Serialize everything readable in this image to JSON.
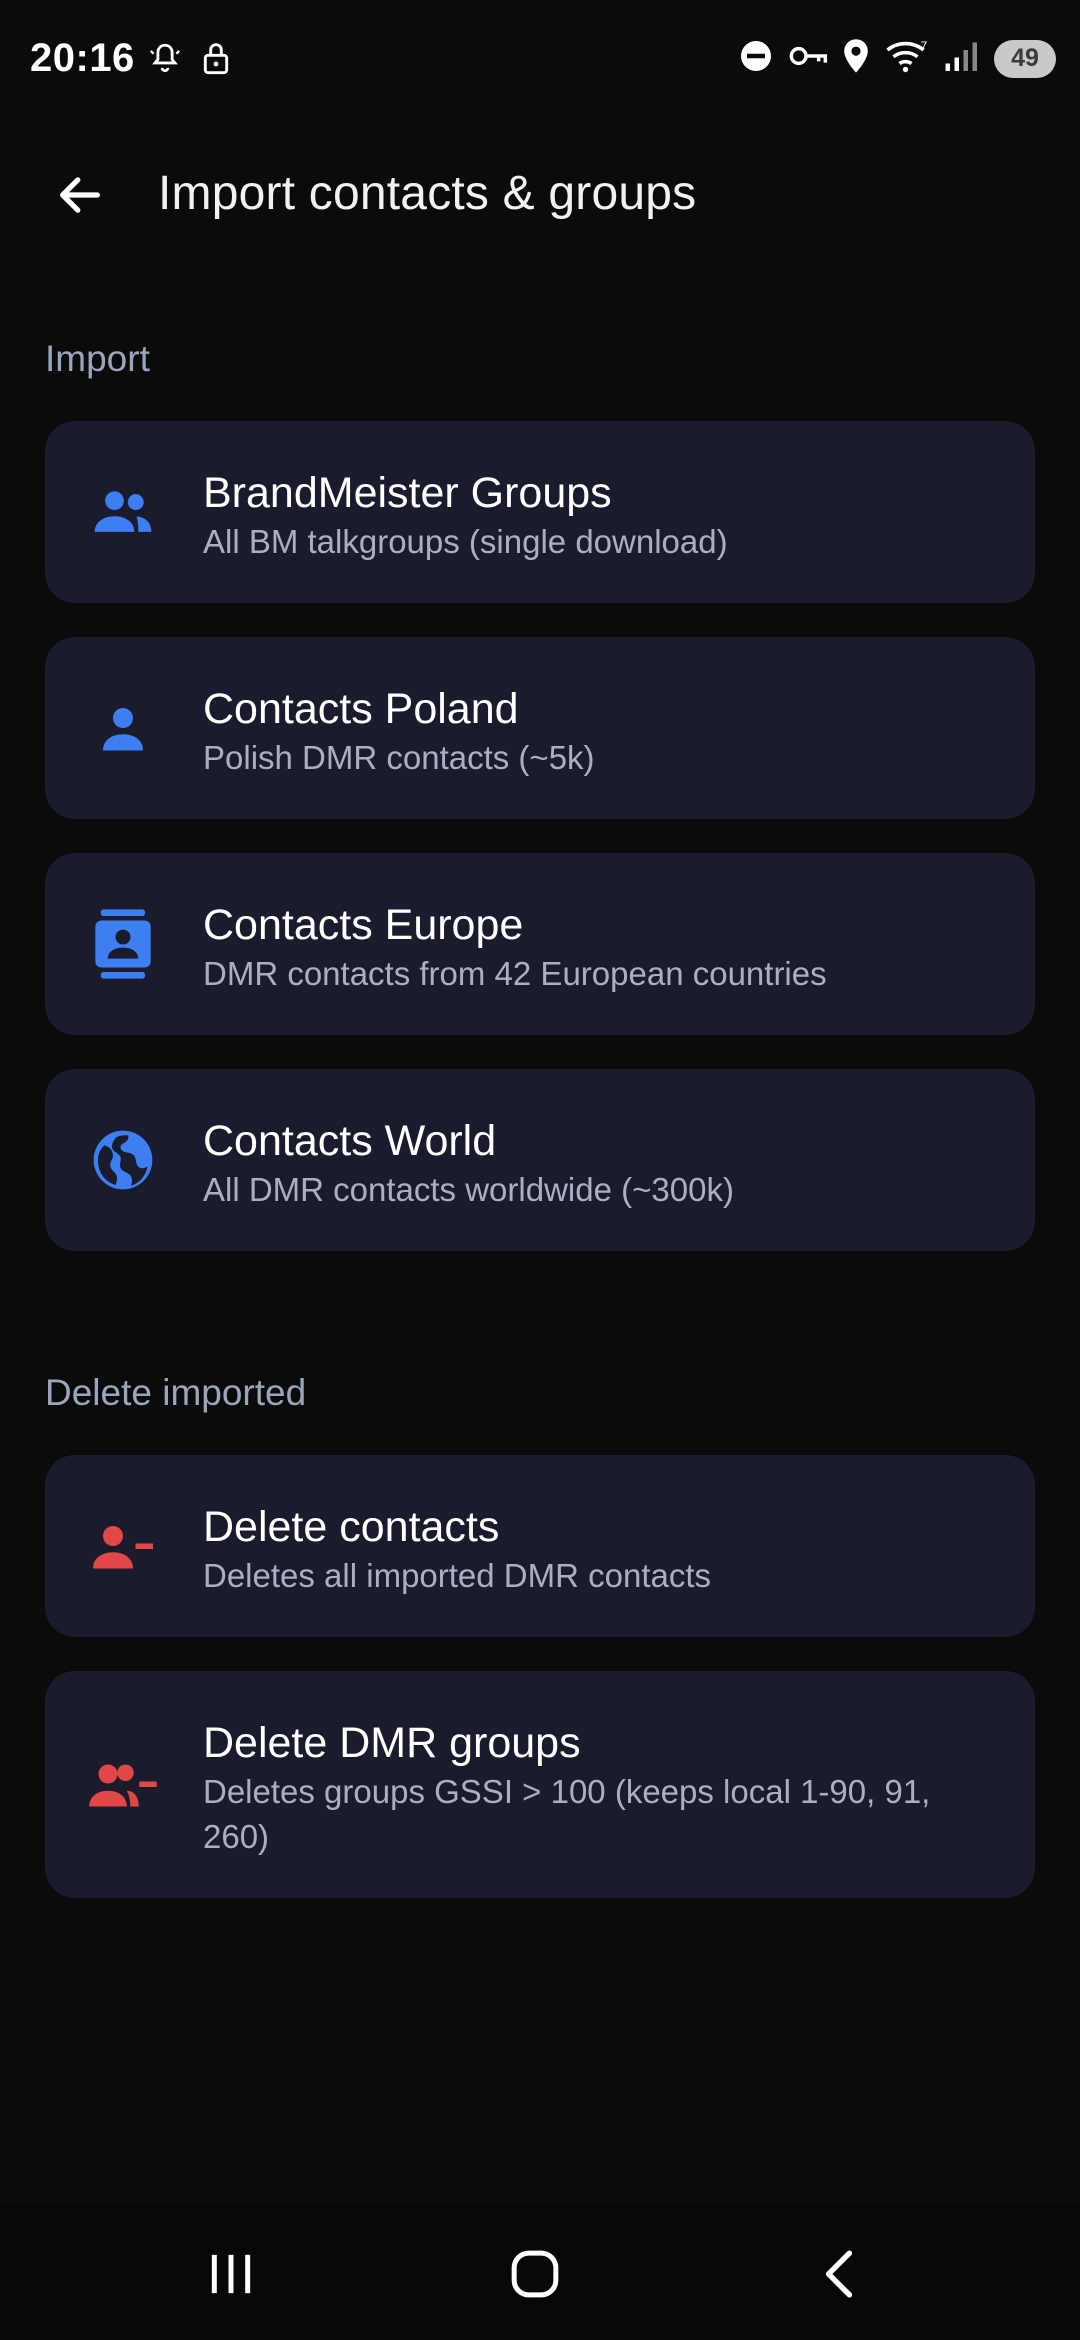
{
  "status_bar": {
    "time": "20:16",
    "battery": "49",
    "icons_left": [
      "vibrate-bell-icon",
      "lock-icon"
    ],
    "icons_right": [
      "do-not-disturb-icon",
      "vpn-key-icon",
      "location-icon",
      "wifi-icon",
      "signal-icon",
      "battery-icon"
    ]
  },
  "app_bar": {
    "title": "Import contacts & groups",
    "back_icon": "arrow-back-icon"
  },
  "import_section": {
    "header": "Import",
    "items": [
      {
        "title": "BrandMeister Groups",
        "subtitle": "All BM talkgroups (single download)",
        "icon": "group-icon"
      },
      {
        "title": "Contacts Poland",
        "subtitle": "Polish DMR contacts (~5k)",
        "icon": "person-icon"
      },
      {
        "title": "Contacts Europe",
        "subtitle": "DMR contacts from 42 European countries",
        "icon": "contact-book-icon"
      },
      {
        "title": "Contacts World",
        "subtitle": "All DMR contacts worldwide (~300k)",
        "icon": "globe-icon"
      }
    ]
  },
  "delete_section": {
    "header": "Delete imported",
    "items": [
      {
        "title": "Delete contacts",
        "subtitle": "Deletes all imported DMR contacts",
        "icon": "person-remove-icon"
      },
      {
        "title": "Delete DMR groups",
        "subtitle": "Deletes groups GSSI > 100 (keeps local 1-90, 91, 260)",
        "icon": "group-remove-icon"
      }
    ]
  },
  "nav_bar": {
    "buttons": [
      "recents-icon",
      "home-icon",
      "back-icon"
    ]
  },
  "colors": {
    "background": "#0b0b0c",
    "card": "#1a1c2d",
    "accent_blue": "#3d7ef0",
    "accent_red": "#e24747",
    "section_header": "#9aa6bc",
    "subtitle": "#a9b0c4"
  }
}
